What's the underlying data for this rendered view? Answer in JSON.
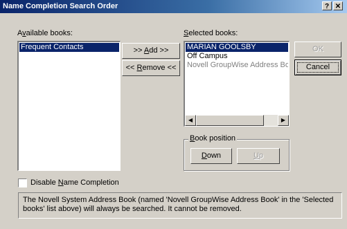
{
  "window": {
    "title": "Name Completion Search Order",
    "help_glyph": "?",
    "close_glyph": "✕"
  },
  "available": {
    "label_pre": "A",
    "label_mn": "v",
    "label_post": "ailable books:",
    "items": [
      {
        "label": "Frequent Contacts"
      }
    ]
  },
  "selected": {
    "label_mn": "S",
    "label_post": "elected books:",
    "items": [
      {
        "label": "MARIAN GOOLSBY"
      },
      {
        "label": "Off Campus"
      },
      {
        "label": "Novell GroupWise Address Book"
      }
    ]
  },
  "buttons": {
    "add_pre": ">> ",
    "add_mn": "A",
    "add_post": "dd >>",
    "remove_pre": "<< ",
    "remove_mn": "R",
    "remove_post": "emove <<",
    "ok": "OK",
    "cancel": "Cancel"
  },
  "book_position": {
    "label_mn": "B",
    "label_post": "ook position",
    "down_mn": "D",
    "down_post": "own",
    "up_mn": "U",
    "up_post": "p"
  },
  "disable_completion": {
    "label_pre": "Disable ",
    "label_mn": "N",
    "label_post": "ame Completion",
    "checked": false
  },
  "info_text": "The Novell System Address Book (named 'Novell GroupWise Address Book' in the 'Selected books' list above) will always be searched.  It cannot be removed.",
  "scroll": {
    "left_arrow": "◀",
    "right_arrow": "▶"
  },
  "colors": {
    "face": "#d4d0c8",
    "selection": "#0a246a",
    "title_gradient_start": "#0a246a"
  }
}
